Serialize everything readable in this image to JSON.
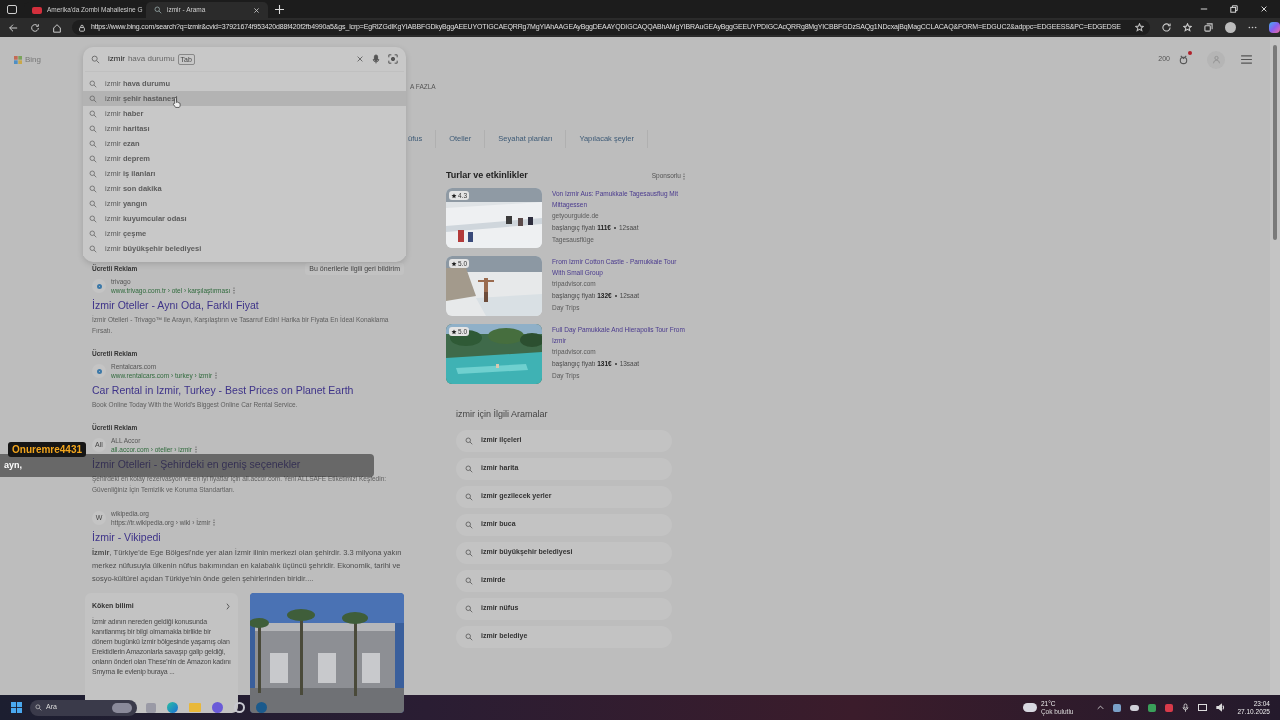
{
  "browser_tabs": [
    {
      "title": "Amerika'da Zombi Mahallesine G",
      "kind": "video",
      "selected": false
    },
    {
      "title": "izmir - Arama",
      "kind": "search",
      "selected": true
    }
  ],
  "address_bar": {
    "url": "https://www.bing.com/search?q=izmir&cvid=37921674f953420d88f420f2fb4990a5&gs_lcrp=EgRlZGdlKgYIABBFGDkyBggAEEUYOTIGCAEQRRg7MgYIAhAAGEAyBggDEAAYQDIGCAQQABhAMgYIBRAuGEAyBggGEEUYPDIGCAcQRRg8MgYICBBFGDzSAQg1NDcxajBqMagCCLACAQ&FORM=EDGUC2&adppc=EDGEESS&PC=EDGEDSE"
  },
  "header": {
    "logo": "Bing",
    "points": "200"
  },
  "search": {
    "value": "izmir",
    "ghost": "hava durumu",
    "key_hint": "Tab"
  },
  "suggestions": [
    {
      "text": "izmir **hava durumu**",
      "selected": false
    },
    {
      "text": "izmir **şehir hastanesi**",
      "selected": true
    },
    {
      "text": "izmir **haber**",
      "selected": false
    },
    {
      "text": "izmir **haritası**",
      "selected": false
    },
    {
      "text": "izmir **ezan**",
      "selected": false
    },
    {
      "text": "izmir **deprem**",
      "selected": false
    },
    {
      "text": "izmir **iş ilanları**",
      "selected": false
    },
    {
      "text": "izmir **son dakika**",
      "selected": false
    },
    {
      "text": "izmir **yangın**",
      "selected": false
    },
    {
      "text": "izmir **kuyumcular odası**",
      "selected": false
    },
    {
      "text": "izmir **çeşme**",
      "selected": false
    },
    {
      "text": "izmir **büyükşehir belediyesi**",
      "selected": false
    }
  ],
  "more_label": "A FAZLA",
  "nav_tabs": [
    "üfus",
    "Oteller",
    "Seyahat planları",
    "Yapılacak şeyler"
  ],
  "results": [
    {
      "kind": "ad",
      "label": "Ücretli Reklam",
      "feedback": "Bu önerilerle ilgili geri bildirim",
      "site": "trivago",
      "url": "www.trivago.com.tr › otel › karşılaştırması",
      "title": "İzmir Oteller - Aynı Oda, Farklı Fiyat",
      "description": "İzmir Otelleri - Trivago™ ile Arayın, Karşılaştırın ve Tasarruf Edin! Harika bir Fiyata En İdeal Konaklama Fırsatı."
    },
    {
      "kind": "ad",
      "label": "Ücretli Reklam",
      "site": "Rentalcars.com",
      "url": "www.rentalcars.com › turkey › izmir",
      "title": "Car Rental in Izmir, Turkey - Best Prices on Planet Earth",
      "description": "Book Online Today With the World's Biggest Online Car Rental Service."
    },
    {
      "kind": "ad",
      "label": "Ücretli Reklam",
      "site": "ALL Accor",
      "favicon": "All",
      "url": "all.accor.com › oteller › izmir",
      "title": "İzmir Otelleri - Şehirdeki en geniş seçenekler",
      "description": "Şehirdeki en kolay rezervasyon ve en iyi fiyatlar için all.accor.com. Yeni ALLSAFE Etiketimizi Keşfedin: Güvenliğiniz İçin Temizlik ve Koruma Standartları."
    },
    {
      "kind": "organic",
      "site": "wikipedia.org",
      "favicon": "W",
      "url": "https://tr.wikipedia.org › wiki › İzmir",
      "title": "İzmir - Vikipedi",
      "description": "**İzmir**, Türkiye'de Ege Bölgesi'nde yer alan İzmir ilinin merkezi olan şehirdir. 3.3 milyona yakın merkez nüfusuyla ülkenin nüfus bakımından en kalabalık üçüncü şehridir. Ekonomik, tarihi ve sosyo-kültürel açıdan Türkiye'nin önde gelen şehirlerinden biridir....",
      "card": {
        "title": "Köken bilimi",
        "text": "İzmir adının nereden geldiği konusunda kanıtlanmış bir bilgi olmamakla birlikte bir dönem bugünkü İzmir bölgesinde yaşamış olan Erektidlerin Amazonlarla savaşıp galip geldiği, onların önderi olan These'nin de Amazon kadını Smyrna ile evlenip buraya ..."
      }
    }
  ],
  "tours": {
    "title": "Turlar ve etkinlikler",
    "sponsor": "Sponsorlu",
    "items": [
      {
        "rating": "4.3",
        "title": "Von Izmir Aus: Pamukkale Tagesausflug Mit Mittagessen",
        "source": "getyourguide.de",
        "price_label": "başlangıç fiyatı",
        "price": "111€",
        "duration": "12saat",
        "category": "Tagesausflüge"
      },
      {
        "rating": "5.0",
        "title": "From Izmir Cotton Castle - Pamukkale Tour With Small Group",
        "source": "tripadvisor.com",
        "price_label": "başlangıç fiyatı",
        "price": "132€",
        "duration": "12saat",
        "category": "Day Trips"
      },
      {
        "rating": "5.0",
        "title": "Full Day Pamukkale And Hierapolis Tour From Izmir",
        "source": "tripadvisor.com",
        "price_label": "başlangıç fiyatı",
        "price": "131€",
        "duration": "13saat",
        "category": "Day Trips"
      }
    ]
  },
  "related": {
    "title": "izmir için İlgili Aramalar",
    "items": [
      "izmir ilçeleri",
      "izmir harita",
      "izmir gezilecek yerler",
      "izmir buca",
      "izmir büyükşehir belediyesi",
      "izmirde",
      "izmir nüfus",
      "izmir belediye"
    ]
  },
  "caption": {
    "user": "Onuremre4431",
    "text": "ayn,"
  },
  "taskbar": {
    "search": "Ara",
    "temperature": "21°C",
    "weather": "Çok bulutlu",
    "time": "23:04",
    "date": "27.10.2025"
  }
}
